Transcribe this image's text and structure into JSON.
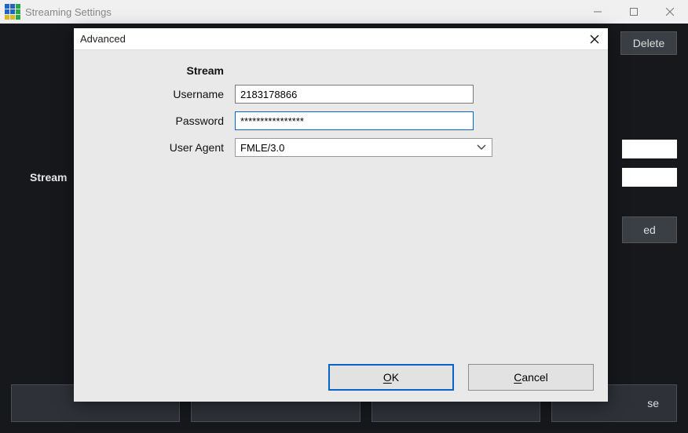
{
  "window": {
    "title": "Streaming Settings",
    "min": "—",
    "max": "☐",
    "close": "✕"
  },
  "background": {
    "delete": "Delete",
    "stream_label": "Stream",
    "btn_ed_suffix": "ed",
    "close_suffix": "se"
  },
  "dialog": {
    "title": "Advanced",
    "section": "Stream",
    "fields": {
      "username": {
        "label": "Username",
        "value": "2183178866"
      },
      "password": {
        "label": "Password",
        "value": "****************"
      },
      "user_agent": {
        "label": "User Agent",
        "value": "FMLE/3.0"
      }
    },
    "buttons": {
      "ok_pre": "",
      "ok_mn": "O",
      "ok_post": "K",
      "cancel_pre": "",
      "cancel_mn": "C",
      "cancel_post": "ancel"
    }
  }
}
